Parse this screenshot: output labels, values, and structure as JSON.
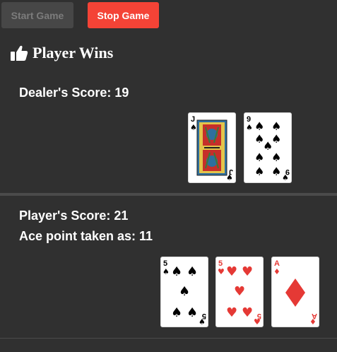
{
  "toolbar": {
    "start_label": "Start Game",
    "stop_label": "Stop Game"
  },
  "result": {
    "text": "Player Wins",
    "icon": "thumbs-up-icon"
  },
  "dealer": {
    "score_text": "Dealer's Score: 19",
    "cards": [
      {
        "rank": "J",
        "suit": "spades",
        "name": "jack-of-spades"
      },
      {
        "rank": "9",
        "suit": "spades",
        "name": "nine-of-spades"
      }
    ]
  },
  "player": {
    "score_text": "Player's Score: 21",
    "ace_text": "Ace point taken as: 11",
    "cards": [
      {
        "rank": "5",
        "suit": "spades",
        "name": "five-of-spades"
      },
      {
        "rank": "5",
        "suit": "hearts",
        "name": "five-of-hearts"
      },
      {
        "rank": "A",
        "suit": "diamonds",
        "name": "ace-of-diamonds"
      }
    ]
  },
  "colors": {
    "background": "#303030",
    "stop_button": "#f44336",
    "start_button": "#474747",
    "red_suit": "#e53935",
    "black_suit": "#000000"
  }
}
